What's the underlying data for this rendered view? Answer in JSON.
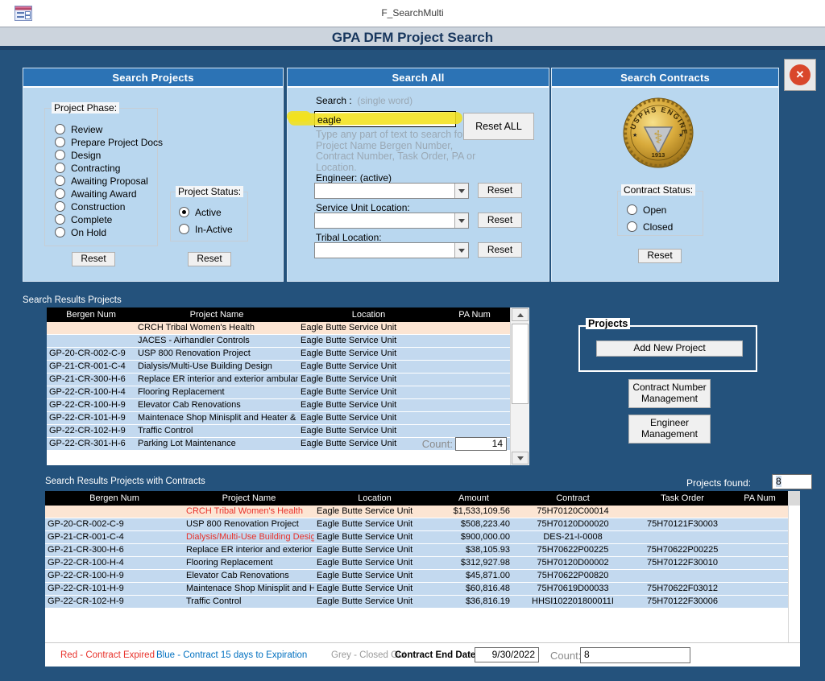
{
  "window": {
    "tab_title": "F_SearchMulti",
    "page_title": "GPA DFM Project Search"
  },
  "icons": {
    "close_glyph": "✕",
    "caduceus": "⚕",
    "star": "★"
  },
  "colors": {
    "page_bg": "#24527c",
    "panel_bg": "#b9d7ef",
    "panel_header": "#2c73b5",
    "table_header": "#000000",
    "row_blue": "#c3d9ef",
    "row_peach": "#fce5d3",
    "expired_red": "#e8312a",
    "legend_blue": "#0070c0",
    "legend_grey": "#9a9a9a",
    "highlighter": "#f3e11c",
    "close_red": "#d9472b"
  },
  "panels": {
    "search_projects": {
      "title": "Search Projects",
      "project_phase": {
        "label": "Project Phase:",
        "options": [
          "Review",
          "Prepare Project Docs",
          "Design",
          "Contracting",
          "Awaiting Proposal",
          "Awaiting Award",
          "Construction",
          "Complete",
          "On Hold"
        ],
        "selected": ""
      },
      "phase_reset_label": "Reset",
      "project_status": {
        "label": "Project Status:",
        "options": [
          "Active",
          "In-Active"
        ],
        "selected": "Active"
      },
      "status_reset_label": "Reset"
    },
    "search_all": {
      "title": "Search All",
      "search_label": "Search :",
      "search_hint": "(single word)",
      "search_value": "eagle",
      "reset_all_label": "Reset ALL",
      "help_text": "Type any part of text to search for\nProject Name Bergen Number,\nContract Number, Task Order, PA or\nLocation.",
      "engineer_label": "Engineer: (active)",
      "engineer_value": "",
      "engineer_reset_label": "Reset",
      "service_unit_label": "Service Unit Location:",
      "service_unit_value": "",
      "service_unit_reset_label": "Reset",
      "tribal_label": "Tribal Location:",
      "tribal_value": "",
      "tribal_reset_label": "Reset"
    },
    "search_contracts": {
      "title": "Search Contracts",
      "seal": {
        "arc_text": "USPHS ENGINEERS",
        "year": "1913"
      },
      "contract_status": {
        "label": "Contract Status:",
        "options": [
          "Open",
          "Closed"
        ],
        "selected": ""
      },
      "reset_label": "Reset"
    }
  },
  "results_projects": {
    "label": "Search Results Projects",
    "columns": [
      "Bergen Num",
      "Project Name",
      "Location",
      "PA Num"
    ],
    "rows": [
      {
        "bergen": "",
        "project": "CRCH Tribal Women's Health",
        "location": "Eagle Butte Service Unit",
        "pa": "",
        "peach": true
      },
      {
        "bergen": "",
        "project": "JACES - Airhandler Controls",
        "location": "Eagle Butte Service Unit",
        "pa": ""
      },
      {
        "bergen": "GP-20-CR-002-C-9",
        "project": "USP 800 Renovation Project",
        "location": "Eagle Butte Service Unit",
        "pa": ""
      },
      {
        "bergen": "GP-21-CR-001-C-4",
        "project": "Dialysis/Multi-Use Building Design",
        "location": "Eagle Butte Service Unit",
        "pa": ""
      },
      {
        "bergen": "GP-21-CR-300-H-6",
        "project": "Replace ER interior and exterior ambulance bay d",
        "location": "Eagle Butte Service Unit",
        "pa": ""
      },
      {
        "bergen": "GP-22-CR-100-H-4",
        "project": "Flooring Replacement",
        "location": "Eagle Butte Service Unit",
        "pa": ""
      },
      {
        "bergen": "GP-22-CR-100-H-9",
        "project": "Elevator Cab Renovations",
        "location": "Eagle Butte Service Unit",
        "pa": ""
      },
      {
        "bergen": "GP-22-CR-101-H-9",
        "project": "Maintenace Shop Minisplit and Heater & ADA Side",
        "location": "Eagle Butte Service Unit",
        "pa": ""
      },
      {
        "bergen": "GP-22-CR-102-H-9",
        "project": "Traffic Control",
        "location": "Eagle Butte Service Unit",
        "pa": ""
      },
      {
        "bergen": "GP-22-CR-301-H-6",
        "project": "Parking Lot Maintenance",
        "location": "Eagle Butte Service Unit",
        "pa": ""
      }
    ],
    "count_label": "Count:",
    "count_value": "14"
  },
  "actions": {
    "projects_label": "Projects",
    "add_new_project_label": "Add New Project",
    "contract_number_management_label": "Contract Number Management",
    "engineer_management_label": "Engineer Management"
  },
  "results_contracts": {
    "label": "Search Results Projects with Contracts",
    "projects_found_label": "Projects found:",
    "projects_found_value": "8",
    "columns": [
      "Bergen Num",
      "Project Name",
      "Location",
      "Amount",
      "Contract",
      "Task Order",
      "PA Num"
    ],
    "rows": [
      {
        "bergen": "",
        "project": "CRCH Tribal Women's Health",
        "location": "Eagle Butte Service Unit",
        "amount": "$1,533,109.56",
        "contract": "75H70120C00014",
        "task_order": "",
        "pa": "",
        "peach": true,
        "red": true
      },
      {
        "bergen": "GP-20-CR-002-C-9",
        "project": "USP 800 Renovation Project",
        "location": "Eagle Butte Service Unit",
        "amount": "$508,223.40",
        "contract": "75H70120D00020",
        "task_order": "75H70121F30003",
        "pa": ""
      },
      {
        "bergen": "GP-21-CR-001-C-4",
        "project": "Dialysis/Multi-Use Building Design",
        "location": "Eagle Butte Service Unit",
        "amount": "$900,000.00",
        "contract": "DES-21-I-0008",
        "task_order": "",
        "pa": "",
        "red": true
      },
      {
        "bergen": "GP-21-CR-300-H-6",
        "project": "Replace ER interior and exterior ambulance bay c",
        "location": "Eagle Butte Service Unit",
        "amount": "$38,105.93",
        "contract": "75H70622P00225",
        "task_order": "75H70622P00225",
        "pa": ""
      },
      {
        "bergen": "GP-22-CR-100-H-4",
        "project": "Flooring Replacement",
        "location": "Eagle Butte Service Unit",
        "amount": "$312,927.98",
        "contract": "75H70120D00002",
        "task_order": "75H70122F30010",
        "pa": ""
      },
      {
        "bergen": "GP-22-CR-100-H-9",
        "project": "Elevator Cab Renovations",
        "location": "Eagle Butte Service Unit",
        "amount": "$45,871.00",
        "contract": "75H70622P00820",
        "task_order": "",
        "pa": ""
      },
      {
        "bergen": "GP-22-CR-101-H-9",
        "project": "Maintenace Shop Minisplit and Heater & ADA Side",
        "location": "Eagle Butte Service Unit",
        "amount": "$60,816.48",
        "contract": "75H70619D00033",
        "task_order": "75H70622F03012",
        "pa": ""
      },
      {
        "bergen": "GP-22-CR-102-H-9",
        "project": "Traffic Control",
        "location": "Eagle Butte Service Unit",
        "amount": "$36,816.19",
        "contract": "HHSI102201800011I",
        "task_order": "75H70122F30006",
        "pa": ""
      }
    ],
    "count_label": "Count:",
    "count_value": "8"
  },
  "legend": {
    "red_label": "Red - Contract Expired",
    "blue_label": "Blue - Contract 15 days to Expiration",
    "grey_label": "Grey - Closed Out",
    "contract_end_date_label": "Contract End Date",
    "contract_end_date_value": "9/30/2022"
  }
}
